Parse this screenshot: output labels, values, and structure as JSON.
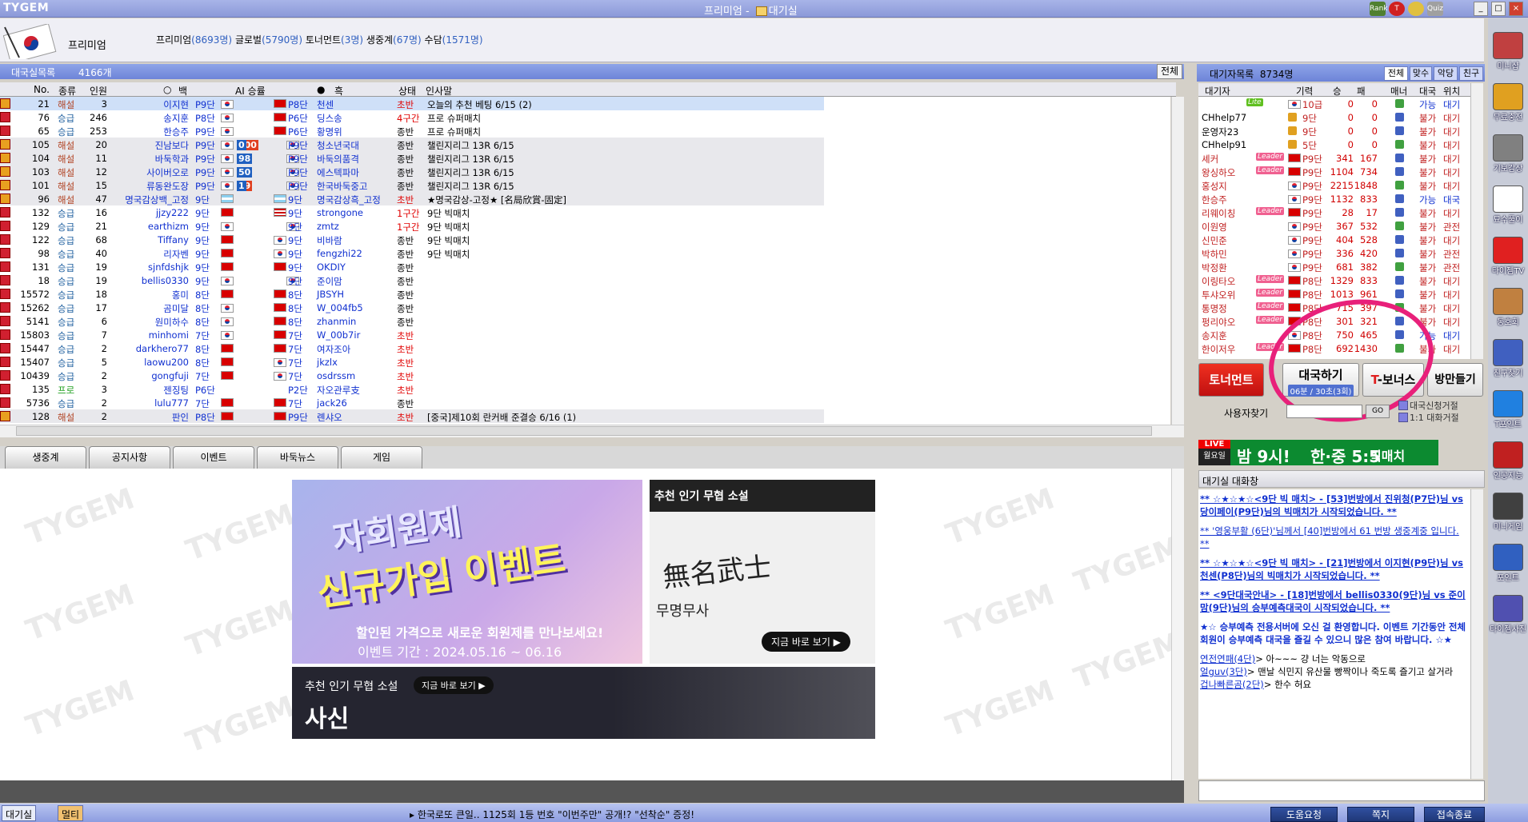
{
  "window": {
    "logo": "TYGEM",
    "title": "프리미엄 - ",
    "title_home": "대기실",
    "btn_min": "_",
    "btn_max": "□",
    "btn_close": "×"
  },
  "top_icons": [
    "Rank",
    "T",
    "Quiz"
  ],
  "header": {
    "room_name": "프리미엄",
    "tabs": [
      {
        "label": "프리미엄",
        "count": "(8693명)"
      },
      {
        "label": "글로벌",
        "count": "(5790명)"
      },
      {
        "label": "토너먼트",
        "count": "(3명)"
      },
      {
        "label": "생중계",
        "count": "(67명)"
      },
      {
        "label": "수담",
        "count": "(1571명)"
      }
    ]
  },
  "game_list": {
    "title": "대국실목록",
    "count": "4166개",
    "all_button": "전체",
    "columns": {
      "no": "No.",
      "type": "종류",
      "people": "인원",
      "white": "백",
      "ai": "AI 승률",
      "black": "흑",
      "status": "상태",
      "greeting": "인사말"
    },
    "rows": [
      {
        "no": "21",
        "type": "해설",
        "people": "3",
        "white": "이지현",
        "wgrade": "P9단",
        "wflag": "kr",
        "bflag": "cn",
        "bgrade": "P8단",
        "black": "천센",
        "status": "초반",
        "greet": "오늘의 추천 베팅 6/15 (2)",
        "sel": true
      },
      {
        "no": "76",
        "type": "승급",
        "people": "246",
        "white": "송지훈",
        "wgrade": "P8단",
        "wflag": "kr",
        "bflag": "cn",
        "bgrade": "P6단",
        "black": "딩스송",
        "status": "4구간",
        "greet": "프로 슈퍼매치"
      },
      {
        "no": "65",
        "type": "승급",
        "people": "253",
        "white": "한승주",
        "wgrade": "P9단",
        "wflag": "kr",
        "bflag": "cn",
        "bgrade": "P6단",
        "black": "황명위",
        "status": "종반",
        "greet": "프로 슈퍼매치"
      },
      {
        "no": "105",
        "type": "해설",
        "people": "20",
        "white": "진남보다",
        "wgrade": "P9단",
        "wflag": "kr",
        "ai_w": "100",
        "ai_b": "0",
        "bflag": "kr",
        "bgrade": "P9단",
        "black": "청소년국대",
        "status": "종반",
        "greet": "챌린지리그 13R 6/15",
        "gray": true
      },
      {
        "no": "104",
        "type": "해설",
        "people": "11",
        "white": "바둑학과",
        "wgrade": "P9단",
        "wflag": "kr",
        "ai_w": "2",
        "ai_b": "98",
        "bflag": "kr",
        "bgrade": "P9단",
        "black": "바둑의품격",
        "status": "종반",
        "greet": "챌린지리그 13R 6/15",
        "gray": true
      },
      {
        "no": "103",
        "type": "해설",
        "people": "12",
        "white": "사이버오로",
        "wgrade": "P9단",
        "wflag": "kr",
        "ai_w": "50",
        "ai_b": "50",
        "bflag": "kr",
        "bgrade": "P9단",
        "black": "에스텍파마",
        "status": "종반",
        "greet": "챌린지리그 13R 6/15",
        "gray": true
      },
      {
        "no": "101",
        "type": "해설",
        "people": "15",
        "white": "류동완도장",
        "wgrade": "P9단",
        "wflag": "kr",
        "ai_w": "99",
        "ai_b": "1",
        "bflag": "kr",
        "bgrade": "P9단",
        "black": "한국바둑중고",
        "status": "종반",
        "greet": "챌린지리그 13R 6/15",
        "gray": true
      },
      {
        "no": "96",
        "type": "해설",
        "people": "47",
        "white": "명국감상백_고정",
        "wgrade": "9단",
        "wflag": "ar",
        "bflag": "ar",
        "bgrade": "9단",
        "black": "명국감상흑_고정",
        "status": "초반",
        "greet": "★명국감상-고정★ [名局欣賞-固定]",
        "gray": true
      },
      {
        "no": "132",
        "type": "승급",
        "people": "16",
        "white": "jjzy222",
        "wgrade": "9단",
        "wflag": "cn",
        "bflag": "us",
        "bgrade": "9단",
        "black": "strongone",
        "status": "1구간",
        "greet": "9단 빅매치"
      },
      {
        "no": "129",
        "type": "승급",
        "people": "21",
        "white": "earthizm",
        "wgrade": "9단",
        "wflag": "kr",
        "bflag": "kr",
        "bgrade": "9단",
        "black": "zmtz",
        "status": "1구간",
        "greet": "9단 빅매치"
      },
      {
        "no": "122",
        "type": "승급",
        "people": "68",
        "white": "Tiffany",
        "wgrade": "9단",
        "wflag": "cn",
        "bflag": "kr",
        "bgrade": "9단",
        "black": "비바람",
        "status": "종반",
        "greet": "9단 빅매치"
      },
      {
        "no": "98",
        "type": "승급",
        "people": "40",
        "white": "리자벤",
        "wgrade": "9단",
        "wflag": "cn",
        "bflag": "kr",
        "bgrade": "9단",
        "black": "fengzhi22",
        "status": "종반",
        "greet": "9단 빅매치"
      },
      {
        "no": "131",
        "type": "승급",
        "people": "19",
        "white": "sjnfdshjk",
        "wgrade": "9단",
        "wflag": "cn",
        "bflag": "cn",
        "bgrade": "9단",
        "black": "OKDIY",
        "status": "종반",
        "greet": ""
      },
      {
        "no": "18",
        "type": "승급",
        "people": "19",
        "white": "bellis0330",
        "wgrade": "9단",
        "wflag": "kr",
        "bflag": "kr",
        "bgrade": "9단",
        "black": "준이맘",
        "status": "종반",
        "greet": ""
      },
      {
        "no": "15572",
        "type": "승급",
        "people": "18",
        "white": "홍미",
        "wgrade": "8단",
        "wflag": "cn",
        "bflag": "cn",
        "bgrade": "8단",
        "black": "JBSYH",
        "status": "종반",
        "greet": ""
      },
      {
        "no": "15262",
        "type": "승급",
        "people": "17",
        "white": "곰미달",
        "wgrade": "8단",
        "wflag": "kr",
        "bflag": "cn",
        "bgrade": "8단",
        "black": "W_004fb5",
        "status": "종반",
        "greet": ""
      },
      {
        "no": "5141",
        "type": "승급",
        "people": "6",
        "white": "원미하수",
        "wgrade": "8단",
        "wflag": "kr",
        "bflag": "cn",
        "bgrade": "8단",
        "black": "zhanmin",
        "status": "종반",
        "greet": ""
      },
      {
        "no": "15803",
        "type": "승급",
        "people": "7",
        "white": "minhomi",
        "wgrade": "7단",
        "wflag": "kr",
        "bflag": "cn",
        "bgrade": "7단",
        "black": "W_00b7ir",
        "status": "초반",
        "greet": ""
      },
      {
        "no": "15447",
        "type": "승급",
        "people": "2",
        "white": "darkhero77",
        "wgrade": "8단",
        "wflag": "cn",
        "bflag": "cn",
        "bgrade": "7단",
        "black": "여자조아",
        "status": "초반",
        "greet": ""
      },
      {
        "no": "15407",
        "type": "승급",
        "people": "5",
        "white": "laowu200",
        "wgrade": "8단",
        "wflag": "cn",
        "bflag": "kr",
        "bgrade": "7단",
        "black": "jkzlx",
        "status": "초반",
        "greet": ""
      },
      {
        "no": "10439",
        "type": "승급",
        "people": "2",
        "white": "gongfuji",
        "wgrade": "7단",
        "wflag": "cn",
        "bflag": "kr",
        "bgrade": "7단",
        "black": "osdrssm",
        "status": "초반",
        "greet": ""
      },
      {
        "no": "135",
        "type": "프로",
        "people": "3",
        "white": "젠징팅",
        "wgrade": "P6단",
        "wflag": "",
        "bflag": "",
        "bgrade": "P2단",
        "black": "자오관루支",
        "status": "초반",
        "greet": ""
      },
      {
        "no": "5736",
        "type": "승급",
        "people": "2",
        "white": "lulu777",
        "wgrade": "7단",
        "wflag": "cn",
        "bflag": "cn",
        "bgrade": "7단",
        "black": "jack26",
        "status": "종반",
        "greet": ""
      },
      {
        "no": "128",
        "type": "해설",
        "people": "2",
        "white": "판인",
        "wgrade": "P8단",
        "wflag": "cn",
        "bflag": "cn",
        "bgrade": "P9단",
        "black": "롄샤오",
        "status": "초반",
        "greet": "[중국]제10회 란커배 준결승 6/16 (1)",
        "gray": true
      }
    ]
  },
  "lower_tabs": [
    "생중계",
    "공지사항",
    "이벤트",
    "바둑뉴스",
    "게임"
  ],
  "watermark": "TYGEM",
  "banners": {
    "event_line1": "자회원제",
    "event_line2": "신규가입 이벤트",
    "event_sub": "할인된 가격으로 새로운 회원제를 만나보세요!",
    "event_period": "이벤트 기간 : 2024.05.16 ~ 06.16",
    "novel_head": "추천 인기 무협 소설",
    "novel_calli": "無名武士",
    "novel_kr": "무명무사",
    "novel_go": "지금 바로 보기 ▶",
    "novel2_head": "추천 인기 무협 소설",
    "novel2_go": "지금 바로 보기 ▶",
    "novel2_title": "사신"
  },
  "waiting": {
    "title": "대기자목록",
    "count": "8734명",
    "tabs": [
      "전체",
      "맞수",
      "악당",
      "친구"
    ],
    "columns": {
      "name": "대기자",
      "grade": "기력",
      "win": "승",
      "loss": "패",
      "manner": "매너",
      "play": "대국",
      "loc": "위치"
    },
    "rows": [
      {
        "name": "",
        "grade": "10급",
        "win": "0",
        "loss": "0",
        "play": "가능",
        "loc": "대기",
        "special": "Lite"
      },
      {
        "name": "CHhelp77",
        "grade": "9단",
        "win": "0",
        "loss": "0",
        "play": "불가",
        "loc": "대기",
        "black": true
      },
      {
        "name": "운영자23",
        "grade": "9단",
        "win": "0",
        "loss": "0",
        "play": "불가",
        "loc": "대기",
        "black": true
      },
      {
        "name": "CHhelp91",
        "grade": "5단",
        "win": "0",
        "loss": "0",
        "play": "불가",
        "loc": "대기",
        "black": true
      },
      {
        "name": "셰커",
        "grade": "P9단",
        "win": "341",
        "loss": "167",
        "play": "불가",
        "loc": "대기",
        "leader": true
      },
      {
        "name": "왕싱하오",
        "grade": "P9단",
        "win": "1104",
        "loss": "734",
        "play": "불가",
        "loc": "대기",
        "leader": true
      },
      {
        "name": "홍성지",
        "grade": "P9단",
        "win": "2215",
        "loss": "1848",
        "play": "불가",
        "loc": "대기"
      },
      {
        "name": "한승주",
        "grade": "P9단",
        "win": "1132",
        "loss": "833",
        "play": "가능",
        "loc": "대국"
      },
      {
        "name": "리웨이칭",
        "grade": "P9단",
        "win": "28",
        "loss": "17",
        "play": "불가",
        "loc": "대기",
        "leader": true
      },
      {
        "name": "이원영",
        "grade": "P9단",
        "win": "367",
        "loss": "532",
        "play": "불가",
        "loc": "관전"
      },
      {
        "name": "신민준",
        "grade": "P9단",
        "win": "404",
        "loss": "528",
        "play": "불가",
        "loc": "대기"
      },
      {
        "name": "박하민",
        "grade": "P9단",
        "win": "336",
        "loss": "420",
        "play": "불가",
        "loc": "관전"
      },
      {
        "name": "박정환",
        "grade": "P9단",
        "win": "681",
        "loss": "382",
        "play": "불가",
        "loc": "관전"
      },
      {
        "name": "이링타오",
        "grade": "P8단",
        "win": "1329",
        "loss": "833",
        "play": "불가",
        "loc": "대기",
        "leader": true
      },
      {
        "name": "투샤오위",
        "grade": "P8단",
        "win": "1013",
        "loss": "961",
        "play": "불가",
        "loc": "대기",
        "leader": true
      },
      {
        "name": "통명정",
        "grade": "P8단",
        "win": "715",
        "loss": "397",
        "play": "불가",
        "loc": "대기",
        "leader": true
      },
      {
        "name": "펑리야오",
        "grade": "P8단",
        "win": "301",
        "loss": "321",
        "play": "불가",
        "loc": "대기",
        "leader": true
      },
      {
        "name": "송지훈",
        "grade": "P8단",
        "win": "750",
        "loss": "465",
        "play": "가능",
        "loc": "대기"
      },
      {
        "name": "한이저우",
        "grade": "P8단",
        "win": "692",
        "loss": "1430",
        "play": "불가",
        "loc": "대기",
        "leader": true
      }
    ],
    "leader_label": "Leader",
    "lite_label": "Lite"
  },
  "actions": {
    "tournament": "토너먼트",
    "play": "대국하기",
    "play_sub": "06분 / 30초(3회)",
    "bonus_t": "T",
    "bonus": "-보너스",
    "room": "방만들기",
    "find_label": "사용자찾기",
    "go": "GO",
    "chk1": "대국신청거절",
    "chk2": "1:1 대화거절"
  },
  "live": {
    "tag": "LIVE",
    "day": "월요일",
    "time": "밤 9시!",
    "match": "한·중 5:5",
    "big": "빅매치"
  },
  "chat": {
    "title": "대기실 대화창",
    "lines": [
      {
        "cls": "n",
        "text": "** ☆★☆★☆<9단 빅 매치> - [53]번방에서 진위청(P7단)님 vs 당이페이(P9단)님의 빅매치가 시작되었습니다. **"
      },
      {
        "cls": "n2",
        "text": "** '영웅부활 (6단)'님께서 [40]번방에서 61 번방 생중계중 입니다. **"
      },
      {
        "cls": "n",
        "text": "** ☆★☆★☆<9단 빅 매치> - [21]번방에서 이지현(P9단)님 vs 천센(P8단)님의 빅매치가 시작되었습니다. **"
      },
      {
        "cls": "n",
        "text": "** <9단대국안내> - [18]번방에서 bellis0330(9단)님 vs 준이맘(9단)님의 승부예측대국이 시작되었습니다. **"
      },
      {
        "cls": "w",
        "text": "★☆ 승부예측 전용서버에 오신 걸 환영합니다. 이벤트 기간동안 전체 회원이 승부예측 대국을 즐길 수 있으니 많은 참여 바랍니다. ☆★"
      }
    ],
    "user_lines": [
      {
        "user": "연전연패(4단)",
        "msg": "> 아~~~ 걍 너는 악동으로"
      },
      {
        "user": "얼guv(3단)",
        "msg": "> 맨날 식민지 유산물 빵짝이나 죽도록 즐기고 살거라"
      },
      {
        "user": "겁나빠른곰(2단)",
        "msg": "> 한수 허요"
      }
    ]
  },
  "statusbar": {
    "tab1": "대기실",
    "tab2": "멀티",
    "ticker": "▸ 한국로또 큰일.. 1125회 1등 번호 \"이번주만\" 공개!? \"선착순\" 증정!",
    "btn_help": "도움요청",
    "btn_note": "쪽지",
    "btn_exit": "접속종료"
  },
  "sidebar": [
    {
      "label": "미니샵",
      "color": "#c04040"
    },
    {
      "label": "무료충전",
      "color": "#e0a020"
    },
    {
      "label": "기보감상",
      "color": "#808080"
    },
    {
      "label": "묘수풀이",
      "color": "#ffffff"
    },
    {
      "label": "타이젬TV",
      "color": "#e02020"
    },
    {
      "label": "동호회",
      "color": "#c08040"
    },
    {
      "label": "친구찾기",
      "color": "#4060c0"
    },
    {
      "label": "T포인트",
      "color": "#2080e0"
    },
    {
      "label": "인공지능",
      "color": "#c02020"
    },
    {
      "label": "미니게임",
      "color": "#404040"
    },
    {
      "label": "포인트",
      "color": "#3060c0"
    },
    {
      "label": "타이젬사진",
      "color": "#5050b0"
    }
  ]
}
